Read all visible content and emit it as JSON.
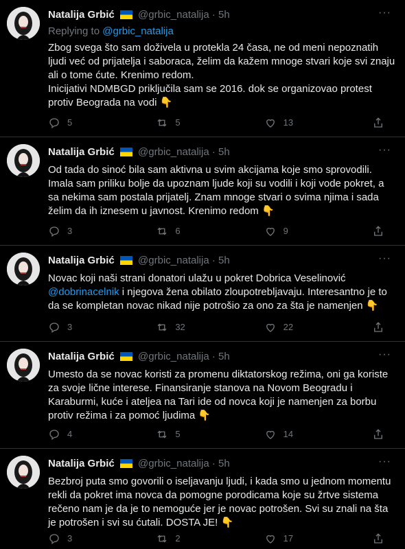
{
  "tweets": [
    {
      "author": "Natalija Grbić",
      "handle": "@grbic_natalija",
      "dot": "·",
      "time": "5h",
      "reply_prefix": "Replying to",
      "reply_to": "@grbic_natalija",
      "text": "Zbog svega što sam doživela u protekla 24 časa, ne od meni nepoznatih\nljudi već od prijatelja i saboraca, želim da kažem mnoge stvari koje svi znaju\nali o tome ćute. Krenimo redom.\nInicijativi NDMBGD priključila sam se 2016. dok se organizovao protest\nprotiv Beograda na vodi 👇",
      "replies": "5",
      "retweets": "5",
      "likes": "13"
    },
    {
      "author": "Natalija Grbić",
      "handle": "@grbic_natalija",
      "dot": "·",
      "time": "5h",
      "text": "Od tada do sinoć bila sam aktivna u svim akcijama koje smo sprovodili.\nImala sam priliku bolje da upoznam ljude koji su vodili i koji vode pokret, a\nsa nekima sam postala prijatelj. Znam mnoge stvari o svima njima i sada\nželim da ih iznesem u javnost. Krenimo redom 👇",
      "replies": "3",
      "retweets": "6",
      "likes": "9"
    },
    {
      "author": "Natalija Grbić",
      "handle": "@grbic_natalija",
      "dot": "·",
      "time": "5h",
      "text_before": "Novac koji naši strani donatori ulažu u pokret Dobrica Veselinović\n",
      "mention": "@dobrinacelnik",
      "text_after": "  i njegova žena obilato zloupotrebljavaju. Interesantno je to\nda se kompletan novac nikad nije potrošio za ono za šta je namenjen 👇",
      "replies": "3",
      "retweets": "32",
      "likes": "22"
    },
    {
      "author": "Natalija Grbić",
      "handle": "@grbic_natalija",
      "dot": "·",
      "time": "5h",
      "text": "Umesto da se novac koristi za promenu diktatorskog režima, oni ga koriste\nza svoje lične interese. Finansiranje stanova na Novom Beogradu i\nKaraburmi, kuće i ateljea na Tari ide od novca koji je namenjen za borbu\nprotiv režima i za pomoć ljudima 👇",
      "replies": "4",
      "retweets": "5",
      "likes": "14"
    },
    {
      "author": "Natalija Grbić",
      "handle": "@grbic_natalija",
      "dot": "·",
      "time": "5h",
      "text": "Bezbroj puta smo govorili o iseljavanju ljudi, i kada smo u jednom momentu\nrekli da pokret ima novca da pomogne porodicama koje su žrtve sistema\nrečeno nam je da je to nemoguće jer je novac potrošen. Svi su znali na šta\nje potrošen i svi su ćutali. DOSTA JE! 👇",
      "replies": "3",
      "retweets": "2",
      "likes": "17"
    }
  ],
  "icons": {
    "reply": "reply-icon",
    "retweet": "retweet-icon",
    "like": "heart-icon",
    "share": "share-icon",
    "more": "more-icon",
    "flag": "ukraine-flag-icon"
  },
  "colors": {
    "background": "#000000",
    "text": "#e7e9ea",
    "muted": "#71767b",
    "link": "#1d9bf0",
    "divider": "#2f3336",
    "flag_blue": "#0057b7",
    "flag_yellow": "#ffd700"
  }
}
